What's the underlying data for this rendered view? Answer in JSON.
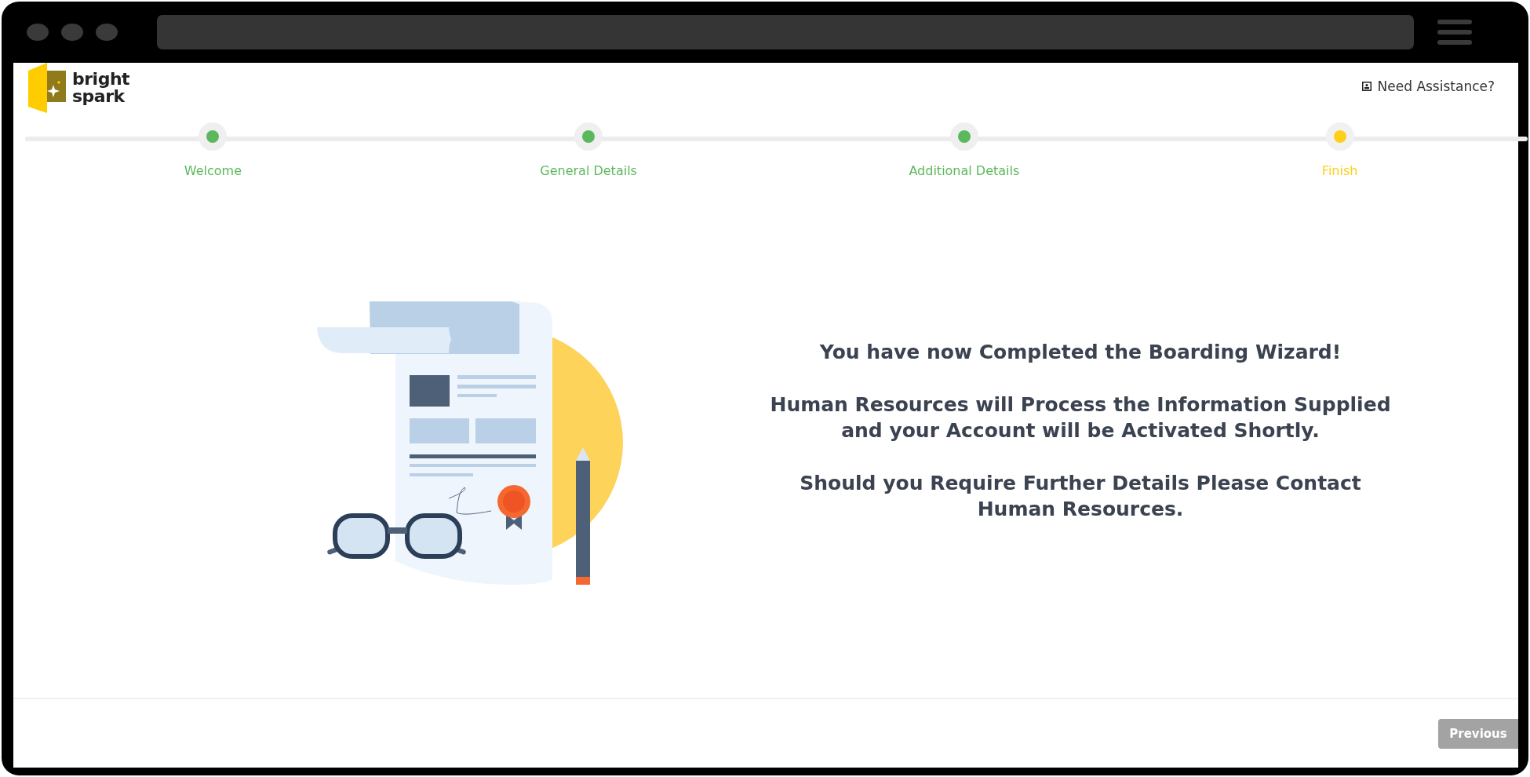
{
  "brand": {
    "line_1": "bright",
    "line_2": "spark"
  },
  "help_link": {
    "label": "Need Assistance?"
  },
  "steps": [
    {
      "label": "Welcome",
      "completed": true,
      "selected": false
    },
    {
      "label": "General Details",
      "completed": true,
      "selected": false
    },
    {
      "label": "Additional Details",
      "completed": true,
      "selected": false
    },
    {
      "label": "Finish",
      "completed": false,
      "selected": true
    }
  ],
  "messages": [
    "You have now Completed the Boarding Wizard!",
    "Human Resources will Process the Information Supplied and your Account will be Activated Shortly.",
    "Should you Require Further Details Please Contact Human Resources."
  ],
  "footer": {
    "button": {
      "label": "Previous",
      "disabled": true
    }
  }
}
